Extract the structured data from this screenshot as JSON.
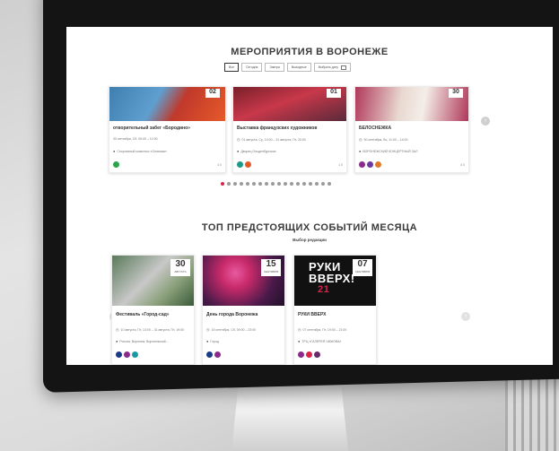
{
  "section1": {
    "title": "МЕРОПРИЯТИЯ В ВОРОНЕЖЕ",
    "filters": [
      "Все",
      "Сегодня",
      "Завтра",
      "Выходные",
      "Выбрать дату"
    ],
    "cards": [
      {
        "title": "отворительный забег «Бородино»",
        "date_badge": "02",
        "date_text": "30 сентября, Сб, 09:00 – 12:00",
        "place": "Спортивный комплекс «Олимпик»",
        "stats": "4   0",
        "tag_colors": [
          "#2aa44a"
        ],
        "image_colors": [
          "#3f7fb0",
          "#c0392b"
        ]
      },
      {
        "title": "Выставка французских художников",
        "date_badge": "01",
        "date_text": "01 августа, Ср, 10:00 – 31 августа, Пт, 20:00",
        "place": "Дворец Ольденбургских",
        "stats": "1   0",
        "tag_colors": [
          "#1a9a8a",
          "#e05a2a"
        ],
        "image_colors": [
          "#7a1f2a",
          "#c8384a"
        ]
      },
      {
        "title": "БЕЛОСНЕЖКА",
        "date_badge": "30",
        "date_text": "30 сентября, Вс, 11:00 – 14:00",
        "place": "ВОРОНЕЖСКИЙ КОНЦЕРТНЫЙ ЗАЛ",
        "stats": "4   0",
        "tag_colors": [
          "#8a2a8a",
          "#6a3aa0",
          "#e07a2a"
        ],
        "image_colors": [
          "#b0385a",
          "#e8d8d0"
        ]
      }
    ],
    "dots_count": 18,
    "active_dot": 0
  },
  "section2": {
    "title": "ТОП ПРЕДСТОЯЩИХ СОБЫТИЙ МЕСЯЦА",
    "subtitle": "Выбор редакции",
    "cards": [
      {
        "day": "30",
        "month": "АВГУСТА",
        "title": "Фестиваль «Город-сад»",
        "date_text": "10 августа, Пт, 13:00 – 31 августа, Пт, 19:00",
        "place": "Россия, Воронеж, Воронежский...",
        "image_colors": [
          "#5a7a5a",
          "#c8c8c8"
        ]
      },
      {
        "day": "15",
        "month": "СЕНТЯБРЯ",
        "title": "День города Воронежа",
        "date_text": "15 сентября, Сб, 09:00 – 23:00",
        "place": "Город",
        "image_colors": [
          "#4a1a4a",
          "#c82a6a"
        ]
      },
      {
        "day": "07",
        "month": "СЕНТЯБРЯ",
        "title": "РУКИ ВВЕРХ",
        "date_text": "07 сентября, Пт, 19:00 – 21:00",
        "place": "ТРЦ «ГАЛЕРЕЯ ЧИЖОВА»",
        "image_text_line1": "РУКИ",
        "image_text_line2": "ВВЕРХ!",
        "image_text_line3": "21",
        "image_colors": [
          "#111111",
          "#d9234a"
        ]
      }
    ]
  }
}
